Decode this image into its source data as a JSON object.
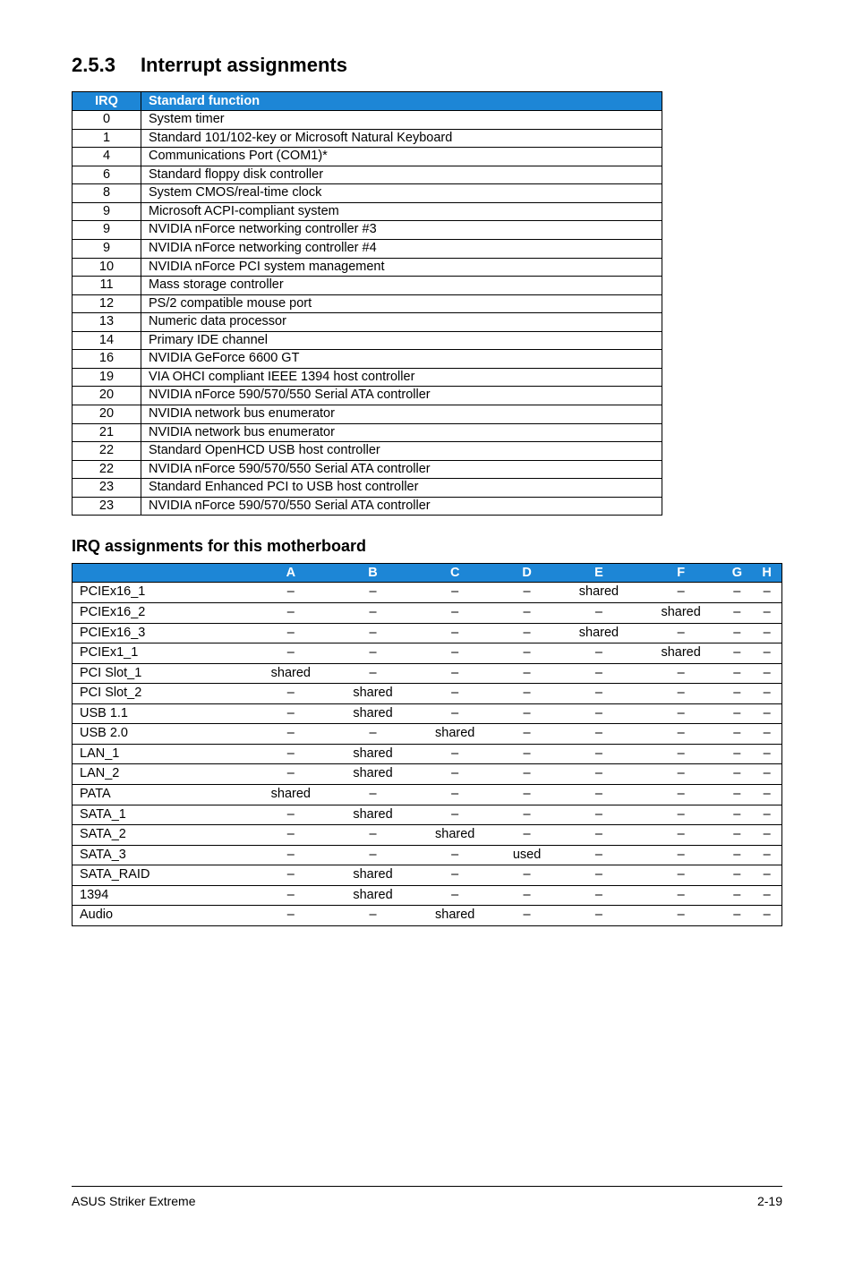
{
  "section": {
    "number": "2.5.3",
    "title": "Interrupt assignments"
  },
  "irq_table": {
    "headers": {
      "irq": "IRQ",
      "func": "Standard function"
    },
    "rows": [
      {
        "irq": "0",
        "func": "System timer"
      },
      {
        "irq": "1",
        "func": "Standard 101/102-key or Microsoft Natural Keyboard"
      },
      {
        "irq": "4",
        "func": "Communications Port (COM1)*"
      },
      {
        "irq": "6",
        "func": "Standard floppy disk controller"
      },
      {
        "irq": "8",
        "func": "System CMOS/real-time clock"
      },
      {
        "irq": "9",
        "func": "Microsoft ACPI-compliant system"
      },
      {
        "irq": "9",
        "func": "NVIDIA nForce networking controller #3"
      },
      {
        "irq": "9",
        "func": "NVIDIA nForce networking controller #4"
      },
      {
        "irq": "10",
        "func": "NVIDIA nForce PCI system management"
      },
      {
        "irq": "11",
        "func": "Mass storage controller"
      },
      {
        "irq": "12",
        "func": "PS/2 compatible mouse port"
      },
      {
        "irq": "13",
        "func": "Numeric data processor"
      },
      {
        "irq": "14",
        "func": "Primary IDE channel"
      },
      {
        "irq": "16",
        "func": "NVIDIA GeForce 6600 GT"
      },
      {
        "irq": "19",
        "func": "VIA OHCI compliant IEEE 1394 host controller"
      },
      {
        "irq": "20",
        "func": "NVIDIA nForce 590/570/550 Serial ATA controller"
      },
      {
        "irq": "20",
        "func": "NVIDIA network bus enumerator"
      },
      {
        "irq": "21",
        "func": "NVIDIA network bus enumerator"
      },
      {
        "irq": "22",
        "func": "Standard OpenHCD USB host controller"
      },
      {
        "irq": "22",
        "func": "NVIDIA nForce 590/570/550 Serial ATA controller"
      },
      {
        "irq": "23",
        "func": "Standard Enhanced PCI to USB host controller"
      },
      {
        "irq": "23",
        "func": "NVIDIA nForce 590/570/550 Serial ATA controller"
      }
    ]
  },
  "subheading": "IRQ assignments for this motherboard",
  "assign_table": {
    "cols": [
      "A",
      "B",
      "C",
      "D",
      "E",
      "F",
      "G",
      "H"
    ],
    "rows": [
      {
        "label": "PCIEx16_1",
        "cells": [
          "–",
          "–",
          "–",
          "–",
          "shared",
          "–",
          "–",
          "–"
        ]
      },
      {
        "label": "PCIEx16_2",
        "cells": [
          "–",
          "–",
          "–",
          "–",
          "–",
          "shared",
          "–",
          "–"
        ]
      },
      {
        "label": "PCIEx16_3",
        "cells": [
          "–",
          "–",
          "–",
          "–",
          "shared",
          "–",
          "–",
          "–"
        ]
      },
      {
        "label": "PCIEx1_1",
        "cells": [
          "–",
          "–",
          "–",
          "–",
          "–",
          "shared",
          "–",
          "–"
        ]
      },
      {
        "label": "PCI Slot_1",
        "cells": [
          "shared",
          "–",
          "–",
          "–",
          "–",
          "–",
          "–",
          "–"
        ]
      },
      {
        "label": "PCI Slot_2",
        "cells": [
          "–",
          "shared",
          "–",
          "–",
          "–",
          "–",
          "–",
          "–"
        ]
      },
      {
        "label": "USB 1.1",
        "cells": [
          "–",
          "shared",
          "–",
          "–",
          "–",
          "–",
          "–",
          "–"
        ]
      },
      {
        "label": "USB 2.0",
        "cells": [
          "–",
          "–",
          "shared",
          "–",
          "–",
          "–",
          "–",
          "–"
        ]
      },
      {
        "label": "LAN_1",
        "cells": [
          "–",
          "shared",
          "–",
          "–",
          "–",
          "–",
          "–",
          "–"
        ]
      },
      {
        "label": "LAN_2",
        "cells": [
          "–",
          "shared",
          "–",
          "–",
          "–",
          "–",
          "–",
          "–"
        ]
      },
      {
        "label": "PATA",
        "cells": [
          "shared",
          "–",
          "–",
          "–",
          "–",
          "–",
          "–",
          "–"
        ]
      },
      {
        "label": "SATA_1",
        "cells": [
          "–",
          "shared",
          "–",
          "–",
          "–",
          "–",
          "–",
          "–"
        ]
      },
      {
        "label": "SATA_2",
        "cells": [
          "–",
          "–",
          "shared",
          "–",
          "–",
          "–",
          "–",
          "–"
        ]
      },
      {
        "label": "SATA_3",
        "cells": [
          "–",
          "–",
          "–",
          "used",
          "–",
          "–",
          "–",
          "–"
        ]
      },
      {
        "label": "SATA_RAID",
        "cells": [
          "–",
          "shared",
          "–",
          "–",
          "–",
          "–",
          "–",
          "–"
        ]
      },
      {
        "label": "1394",
        "cells": [
          "–",
          "shared",
          "–",
          "–",
          "–",
          "–",
          "–",
          "–"
        ]
      },
      {
        "label": "Audio",
        "cells": [
          "–",
          "–",
          "shared",
          "–",
          "–",
          "–",
          "–",
          "–"
        ]
      }
    ]
  },
  "footer": {
    "left": "ASUS Striker Extreme",
    "right": "2-19"
  }
}
